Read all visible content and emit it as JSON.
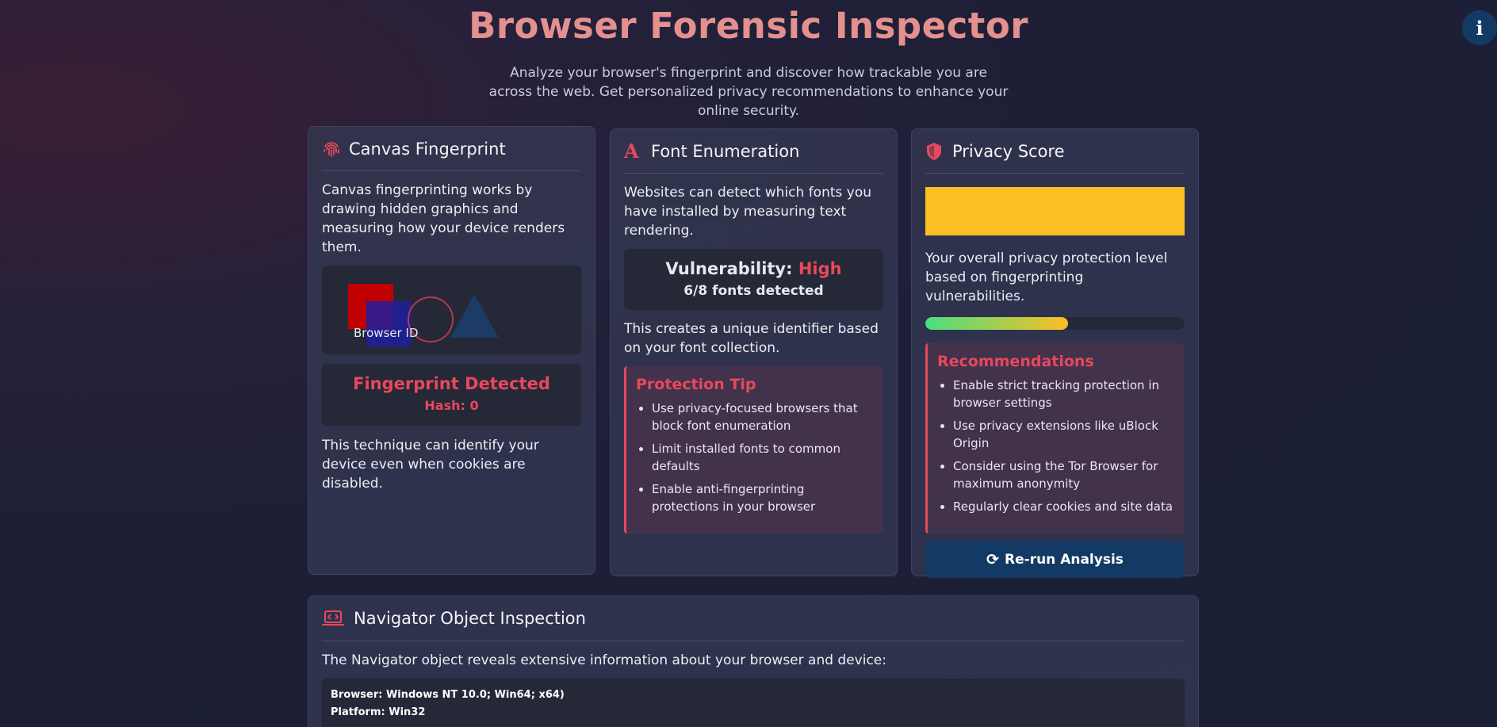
{
  "header": {
    "title": "Browser Forensic Inspector",
    "subtitle": "Analyze your browser's fingerprint and discover how trackable you are across the web. Get personalized privacy recommendations to enhance your online security.",
    "info_label": "i"
  },
  "canvas_card": {
    "title": "Canvas Fingerprint",
    "description": "Canvas fingerprinting works by drawing hidden graphics and measuring how your device renders them.",
    "canvas_text": "Browser ID",
    "status": "Fingerprint Detected",
    "hash": "Hash: 0",
    "footer": "This technique can identify your device even when cookies are disabled."
  },
  "font_card": {
    "title": "Font Enumeration",
    "description": "Websites can detect which fonts you have installed by measuring text rendering.",
    "vulnerability_label": "Vulnerability:",
    "vulnerability_value": "High",
    "fonts_detected": "6/8 fonts detected",
    "note": "This creates a unique identifier based on your font collection.",
    "tip_title": "Protection Tip",
    "tips": [
      "Use privacy-focused browsers that block font enumeration",
      "Limit installed fonts to common defaults",
      "Enable anti-fingerprinting protections in your browser"
    ]
  },
  "privacy_card": {
    "title": "Privacy Score",
    "score_bar_color": "#fbbf24",
    "description": "Your overall privacy protection level based on fingerprinting vulnerabilities.",
    "progress_fraction": 0.55,
    "rec_title": "Recommendations",
    "recommendations": [
      "Enable strict tracking protection in browser settings",
      "Use privacy extensions like uBlock Origin",
      "Consider using the Tor Browser for maximum anonymity",
      "Regularly clear cookies and site data"
    ],
    "rerun_label": "Re-run Analysis"
  },
  "navigator_card": {
    "title": "Navigator Object Inspection",
    "description": "The Navigator object reveals extensive information about your browser and device:",
    "rows": [
      "Browser: Windows NT 10.0; Win64; x64)",
      "Platform: Win32"
    ]
  },
  "colors": {
    "accent": "#e8485c",
    "button": "#133a64",
    "title": "#e3908f"
  }
}
